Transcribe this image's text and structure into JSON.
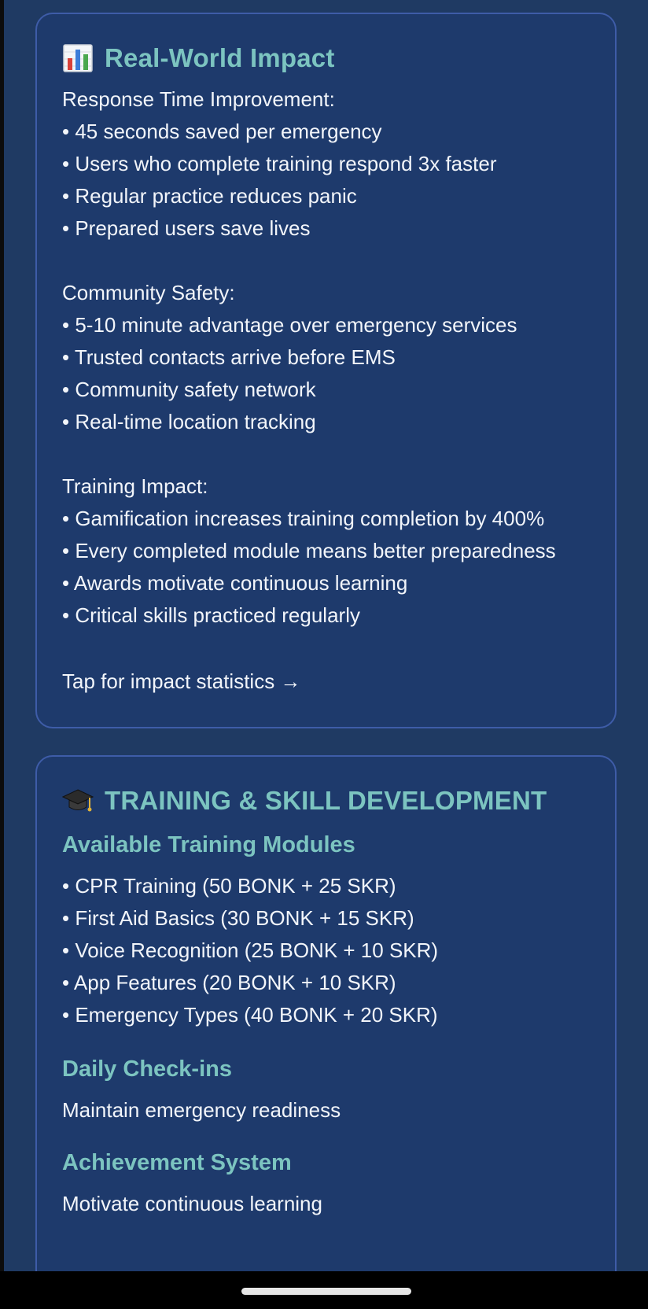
{
  "impact_card": {
    "icon": "bar-chart-icon",
    "title": "Real-World Impact",
    "groups": [
      {
        "heading": "Response Time Improvement:",
        "items": [
          "• 45 seconds saved per emergency",
          "• Users who complete training respond 3x faster",
          "• Regular practice reduces panic",
          "• Prepared users save lives"
        ]
      },
      {
        "heading": "Community Safety:",
        "items": [
          "• 5-10 minute advantage over emergency services",
          "• Trusted contacts arrive before EMS",
          "• Community safety network",
          "• Real-time location tracking"
        ]
      },
      {
        "heading": "Training Impact:",
        "items": [
          "• Gamification increases training completion by 400%",
          "• Every completed module means better preparedness",
          "• Awards motivate continuous learning",
          "• Critical skills practiced regularly"
        ]
      }
    ],
    "tap_label": "Tap for impact statistics →"
  },
  "training_card": {
    "icon": "graduation-cap-icon",
    "title": "TRAINING & SKILL DEVELOPMENT",
    "sections": [
      {
        "heading": "Available Training Modules",
        "items": [
          "• CPR Training (50 BONK + 25 SKR)",
          "• First Aid Basics (30 BONK + 15 SKR)",
          "• Voice Recognition (25 BONK + 10 SKR)",
          "• App Features (20 BONK + 10 SKR)",
          "• Emergency Types (40 BONK + 20 SKR)"
        ]
      },
      {
        "heading": "Daily Check-ins",
        "description": "Maintain emergency readiness"
      },
      {
        "heading": "Achievement System",
        "description": "Motivate continuous learning"
      }
    ]
  },
  "colors": {
    "background": "#1f3a63",
    "card": "#1e3a6c",
    "card_border": "#3e5ca8",
    "accent_teal": "#7cc4c0",
    "text": "#f2f5fa"
  }
}
